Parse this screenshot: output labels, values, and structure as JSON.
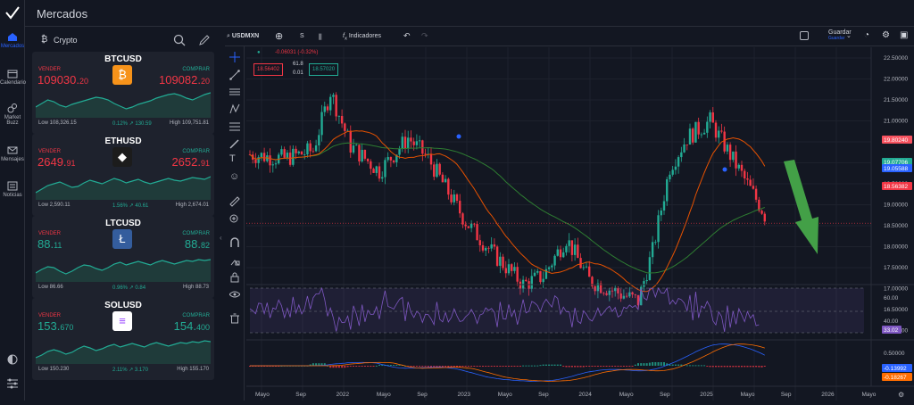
{
  "app": {
    "title": "Mercados"
  },
  "rail": {
    "items": [
      {
        "label": "Mercados",
        "icon": "home-icon"
      },
      {
        "label": "Calendario",
        "icon": "calendar-icon"
      },
      {
        "label": "Market Buzz",
        "icon": "buzz-icon"
      },
      {
        "label": "Mensajes",
        "icon": "message-icon"
      },
      {
        "label": "Noticias",
        "icon": "news-icon"
      }
    ]
  },
  "panel": {
    "category": "Crypto"
  },
  "cards": [
    {
      "symbol": "BTCUSD",
      "sell_label": "VENDER",
      "buy_label": "COMPRAR",
      "sell_main": "109030.",
      "sell_frac": "20",
      "buy_main": "109082.",
      "buy_frac": "20",
      "low": "Low 108,326.15",
      "change": "0.12% ↗ 130.59",
      "high": "High 109,751.81",
      "sell_color": "#f23645",
      "buy_color": "#f23645",
      "logo_color": "#f7931a",
      "logo_glyph": "₿"
    },
    {
      "symbol": "ETHUSD",
      "sell_label": "VENDER",
      "buy_label": "COMPRAR",
      "sell_main": "2649.",
      "sell_frac": "91",
      "buy_main": "2652.",
      "buy_frac": "91",
      "low": "Low 2,590.11",
      "change": "1.56% ↗ 40.61",
      "high": "High 2,674.01",
      "sell_color": "#f23645",
      "buy_color": "#f23645",
      "logo_color": "#1c1c1c",
      "logo_glyph": "◆"
    },
    {
      "symbol": "LTCUSD",
      "sell_label": "VENDER",
      "buy_label": "COMPRAR",
      "sell_main": "88.",
      "sell_frac": "11",
      "buy_main": "88.",
      "buy_frac": "82",
      "low": "Low 86.66",
      "change": "0.96% ↗ 0.84",
      "high": "High 88.73",
      "sell_color": "#22ab94",
      "buy_color": "#22ab94",
      "logo_color": "#345d9d",
      "logo_glyph": "Ł"
    },
    {
      "symbol": "SOLUSD",
      "sell_label": "VENDER",
      "buy_label": "COMPRAR",
      "sell_main": "153.",
      "sell_frac": "670",
      "buy_main": "154.",
      "buy_frac": "400",
      "low": "Low 150.230",
      "change": "2.11% ↗ 3.170",
      "high": "High 155.170",
      "sell_color": "#22ab94",
      "buy_color": "#22ab94",
      "logo_color": "#ffffff",
      "logo_glyph": "≡"
    }
  ],
  "toolbar": {
    "symbol": "USDMXN",
    "interval": "S",
    "indicators": "Indicadores",
    "save": "Guardar",
    "save_sub": "Guardar"
  },
  "legend": {
    "change": "-0.06031 (-0.32%)",
    "bid": "18.56402",
    "spread_top": "61.8",
    "spread": "0.01",
    "ask": "18.57020"
  },
  "price_axis": {
    "ticks": [
      "22.50000",
      "22.00000",
      "21.50000",
      "21.00000",
      "20.50000",
      "20.00000",
      "19.50000",
      "19.00000",
      "18.50000",
      "18.00000",
      "17.50000",
      "17.00000",
      "16.50000",
      "16.00000"
    ],
    "badges": [
      {
        "text": "19.80240",
        "color": "#f7525f"
      },
      {
        "text": "19.07706",
        "color": "#22ab94"
      },
      {
        "text": "19.05588",
        "color": "#2962ff"
      },
      {
        "text": "18.56382",
        "color": "#f23645"
      }
    ]
  },
  "rsi": {
    "ticks": [
      "60.00",
      "40.00"
    ],
    "value": "33.02"
  },
  "macd": {
    "ticks": [
      "0.50000"
    ],
    "values": [
      "-0.13992",
      "-0.18267"
    ]
  },
  "time_axis": [
    "Mayo",
    "Sep",
    "2022",
    "Mayo",
    "Sep",
    "2023",
    "Mayo",
    "Sep",
    "2024",
    "Mayo",
    "Sep",
    "2025",
    "Mayo",
    "Sep",
    "2026",
    "Mayo"
  ],
  "colors": {
    "up": "#22ab94",
    "down": "#f23645",
    "ma_long": "#2e7d32",
    "ma_short": "#e65100",
    "rsi": "#7e57c2",
    "arrow": "#43a047"
  }
}
